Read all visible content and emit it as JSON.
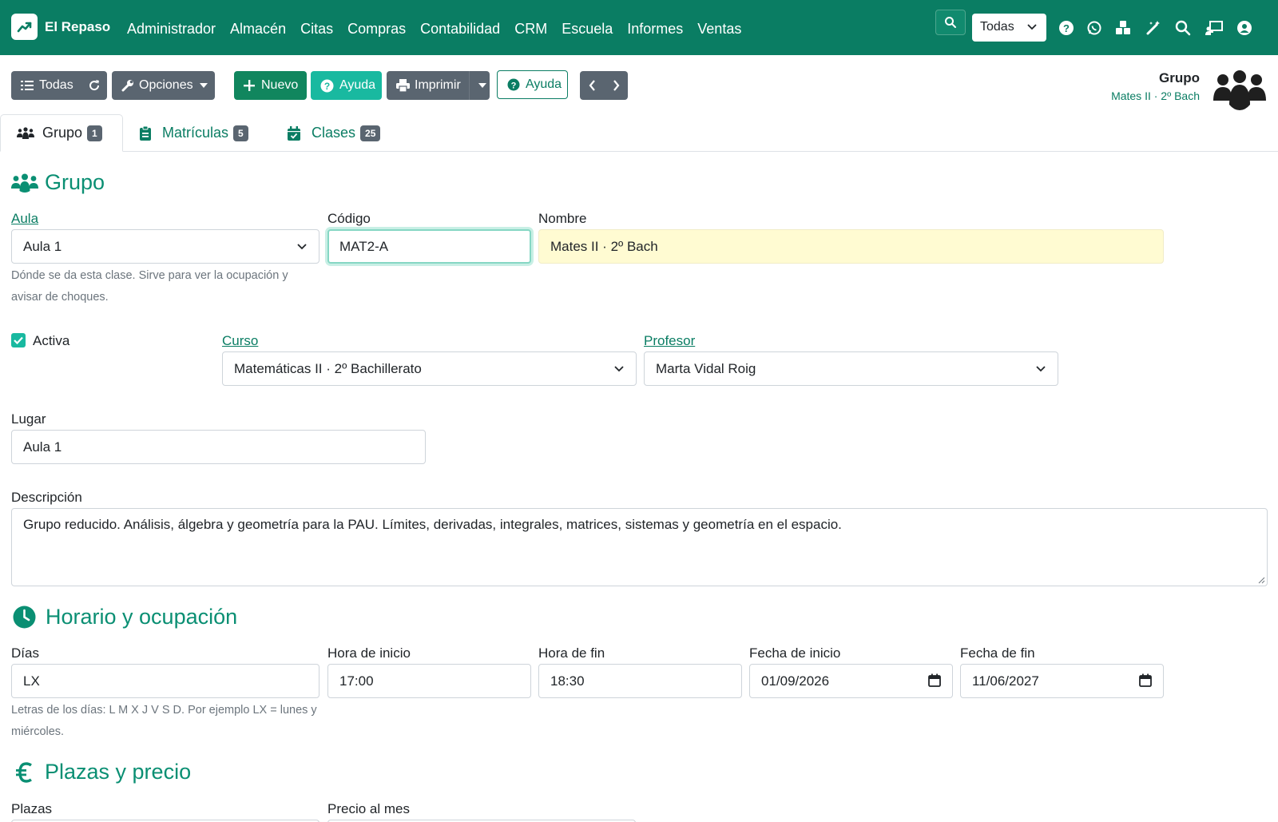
{
  "brand": {
    "name": "El Repaso"
  },
  "menu": [
    "Administrador",
    "Almacén",
    "Citas",
    "Compras",
    "Contabilidad",
    "CRM",
    "Escuela",
    "Informes",
    "Ventas"
  ],
  "nav": {
    "scope_select": "Todas"
  },
  "toolbar": {
    "list_all": "Todas",
    "options": "Opciones",
    "new": "Nuevo",
    "help": "Ayuda",
    "print": "Imprimir",
    "help_outline": "Ayuda"
  },
  "record_header": {
    "title": "Grupo",
    "subtitle": "Mates II · 2º Bach"
  },
  "tabs": [
    {
      "label": "Grupo",
      "count": "1"
    },
    {
      "label": "Matrículas",
      "count": "5"
    },
    {
      "label": "Clases",
      "count": "25"
    }
  ],
  "sections": {
    "group": "Grupo",
    "schedule": "Horario y ocupación",
    "pricing": "Plazas y precio"
  },
  "form": {
    "aula": {
      "label": "Aula",
      "value": "Aula 1",
      "help": "Dónde se da esta clase. Sirve para ver la ocupación y avisar de choques."
    },
    "codigo": {
      "label": "Código",
      "value": "MAT2-A"
    },
    "nombre": {
      "label": "Nombre",
      "value": "Mates II · 2º Bach"
    },
    "activa": {
      "label": "Activa",
      "checked": true
    },
    "curso": {
      "label": "Curso",
      "value": "Matemáticas II · 2º Bachillerato"
    },
    "profesor": {
      "label": "Profesor",
      "value": "Marta Vidal Roig"
    },
    "lugar": {
      "label": "Lugar",
      "value": "Aula 1"
    },
    "descripcion": {
      "label": "Descripción",
      "value": "Grupo reducido. Análisis, álgebra y geometría para la PAU. Límites, derivadas, integrales, matrices, sistemas y geometría en el espacio."
    },
    "dias": {
      "label": "Días",
      "value": "LX",
      "help": "Letras de los días: L M X J V S D. Por ejemplo LX = lunes y miércoles."
    },
    "hora_inicio": {
      "label": "Hora de inicio",
      "value": "17:00"
    },
    "hora_fin": {
      "label": "Hora de fin",
      "value": "18:30"
    },
    "fecha_inicio": {
      "label": "Fecha de inicio",
      "value": "01/09/2026"
    },
    "fecha_fin": {
      "label": "Fecha de fin",
      "value": "11/06/2027"
    },
    "plazas": {
      "label": "Plazas"
    },
    "precio_mes": {
      "label": "Precio al mes"
    }
  },
  "colors": {
    "primary": "#0a7d63",
    "accent": "#19b9a0",
    "secondary": "#5a6570"
  }
}
